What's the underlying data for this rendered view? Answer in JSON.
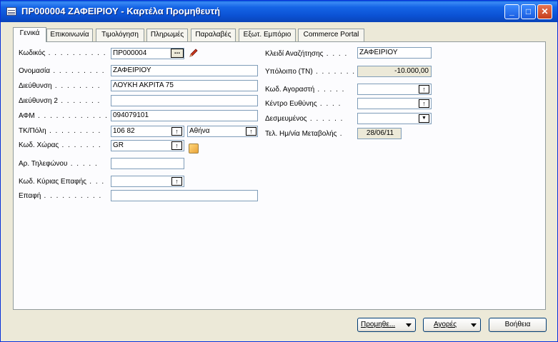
{
  "window": {
    "title": "ΠΡ000004 ΖΑΦΕΙΡΙΟΥ - Καρτέλα Προμηθευτή",
    "minimize": "_",
    "maximize": "□",
    "close": "✕"
  },
  "tabs": [
    {
      "label": "Γενικά"
    },
    {
      "label": "Επικοινωνία"
    },
    {
      "label": "Τιμολόγηση"
    },
    {
      "label": "Πληρωμές"
    },
    {
      "label": "Παραλαβές"
    },
    {
      "label": "Εξωτ. Εμπόριο"
    },
    {
      "label": "Commerce Portal"
    }
  ],
  "left": {
    "code_label": "Κωδικός",
    "code_value": "ΠΡ000004",
    "name_label": "Ονομασία",
    "name_value": "ΖΑΦΕΙΡΙΟΥ",
    "address_label": "Διεύθυνση",
    "address_value": "ΛΟΥΚΗ ΑΚΡΙΤΑ 75",
    "address2_label": "Διεύθυνση 2",
    "address2_value": "",
    "vat_label": "ΑΦΜ",
    "vat_value": "094079101",
    "postcode_label": "ΤΚ/Πόλη",
    "postcode_value": "106 82",
    "city_value": "Αθήνα",
    "country_label": "Κωδ. Χώρας",
    "country_value": "GR",
    "phone_label": "Αρ. Τηλεφώνου",
    "phone_value": "",
    "contact_code_label": "Κωδ. Κύριας Επαφής",
    "contact_code_value": "",
    "contact_label": "Επαφή",
    "contact_value": ""
  },
  "right": {
    "search_label": "Κλειδί Αναζήτησης",
    "search_value": "ΖΑΦΕΙΡΙΟΥ",
    "balance_label": "Υπόλοιπο (ΤΝ)",
    "balance_value": "-10.000,00",
    "buyer_label": "Κωδ. Αγοραστή",
    "buyer_value": "",
    "resp_label": "Κέντρο Ευθύνης",
    "resp_value": "",
    "blocked_label": "Δεσμευμένος",
    "blocked_value": "",
    "modified_label": "Τελ. Ημ/νία Μεταβολής",
    "modified_value": "28/06/11"
  },
  "buttons": {
    "vendor": "Προμηθε...",
    "purchases": "Αγορές",
    "help": "Βοήθεια"
  },
  "icons": {
    "lookup": "↑",
    "ellipsis": "...",
    "dropdown": "▼"
  }
}
